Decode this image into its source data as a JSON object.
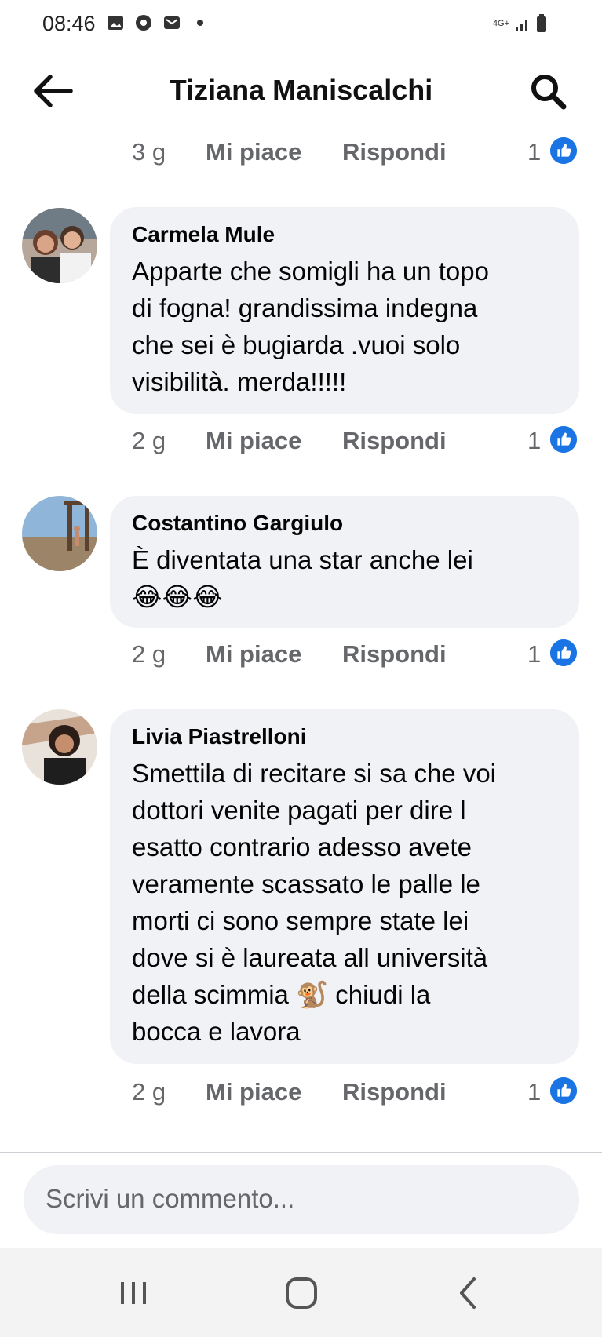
{
  "status_bar": {
    "time": "08:46",
    "network": "4G+"
  },
  "header": {
    "title": "Tiziana Maniscalchi"
  },
  "comments": [
    {
      "author": "",
      "text": "",
      "time": "3 g",
      "like_label": "Mi piace",
      "reply_label": "Rispondi",
      "reaction_count": "1"
    },
    {
      "author": "Carmela Mule",
      "text": "Apparte che somigli ha un topo\ndi fogna! grandissima indegna\nche sei è bugiarda .vuoi solo\nvisibilità. merda!!!!!",
      "time": "2 g",
      "like_label": "Mi piace",
      "reply_label": "Rispondi",
      "reaction_count": "1"
    },
    {
      "author": "Costantino Gargiulo",
      "text": "È diventata una star anche lei\n😂😂😂",
      "time": "2 g",
      "like_label": "Mi piace",
      "reply_label": "Rispondi",
      "reaction_count": "1"
    },
    {
      "author": "Livia Piastrelloni",
      "text": "Smettila di recitare si sa che voi\ndottori venite pagati per dire l\nesatto contrario adesso avete\nveramente scassato le palle le\nmorti ci sono sempre state lei\ndove si è laureata all università\ndella scimmia 🐒 chiudi la\nbocca e lavora",
      "time": "2 g",
      "like_label": "Mi piace",
      "reply_label": "Rispondi",
      "reaction_count": "1"
    }
  ],
  "composer": {
    "placeholder": "Scrivi un commento..."
  },
  "colors": {
    "accent": "#1b74e4",
    "bubble": "#f0f2f5",
    "meta_text": "#65676b"
  }
}
